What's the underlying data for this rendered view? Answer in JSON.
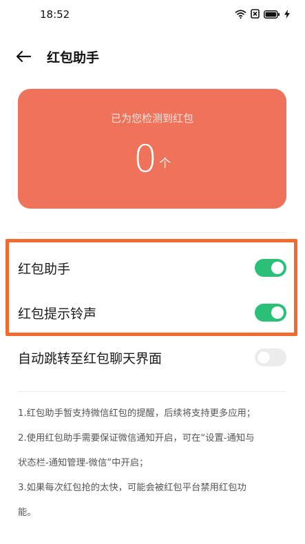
{
  "status_bar": {
    "time": "18:52"
  },
  "header": {
    "title": "红包助手"
  },
  "card": {
    "subtitle": "已为您检测到红包",
    "count": "0",
    "unit": "个",
    "color": "#ee735a"
  },
  "settings": [
    {
      "label": "红包助手",
      "enabled": true
    },
    {
      "label": "红包提示铃声",
      "enabled": true
    },
    {
      "label": "自动跳转至红包聊天界面",
      "enabled": false
    }
  ],
  "notes": [
    "1.红包助手暂支持微信红包的提醒，后续将支持更多应用；",
    "2.使用红包助手需要保证微信通知开启，可在“设置-通知与",
    "状态栏-通知管理-微信”中开启；",
    "3.如果每次红包抢的太快，可能会被红包平台禁用红包功",
    "能。"
  ],
  "colors": {
    "toggle_on": "#2bbf78",
    "toggle_off": "#ececec",
    "highlight": "#f06b30"
  }
}
